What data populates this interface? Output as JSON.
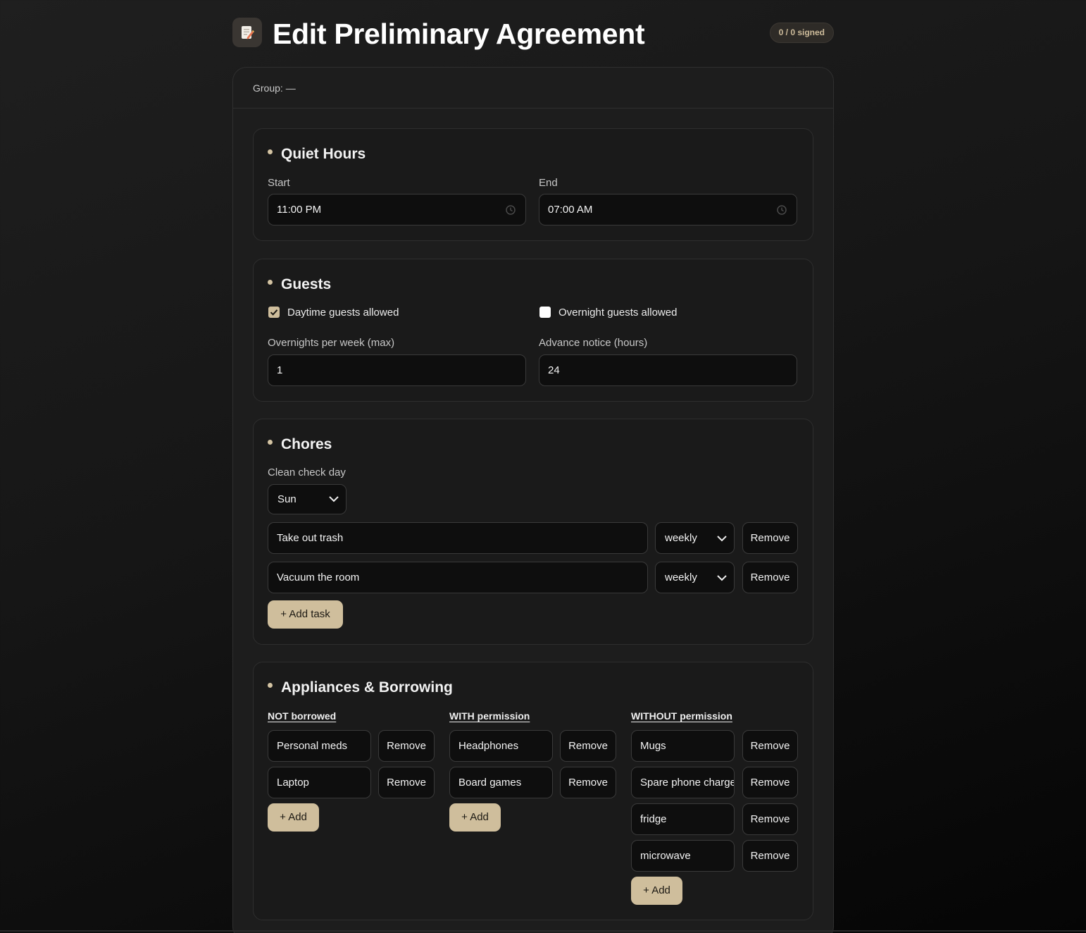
{
  "header": {
    "title": "Edit Preliminary Agreement",
    "signed_badge": "0 / 0 signed",
    "icon": "memo-pencil-icon"
  },
  "card": {
    "group_label": "Group: —"
  },
  "quiet_hours": {
    "title": "Quiet Hours",
    "start_label": "Start",
    "start_value": "11:00 PM",
    "end_label": "End",
    "end_value": "07:00 AM"
  },
  "guests": {
    "title": "Guests",
    "daytime_label": "Daytime guests allowed",
    "daytime_checked": true,
    "overnight_label": "Overnight guests allowed",
    "overnight_checked": false,
    "overnights_label": "Overnights per week (max)",
    "overnights_value": "1",
    "notice_label": "Advance notice (hours)",
    "notice_value": "24"
  },
  "chores": {
    "title": "Chores",
    "clean_day_label": "Clean check day",
    "clean_day_value": "Sun",
    "tasks": [
      {
        "name": "Take out trash",
        "frequency": "weekly",
        "remove": "Remove"
      },
      {
        "name": "Vacuum the room",
        "frequency": "weekly",
        "remove": "Remove"
      }
    ],
    "add_task": "+ Add task"
  },
  "appliances": {
    "title": "Appliances & Borrowing",
    "columns": [
      {
        "heading": "NOT borrowed",
        "items": [
          "Personal meds",
          "Laptop"
        ],
        "add": "+ Add"
      },
      {
        "heading": "WITH permission",
        "items": [
          "Headphones",
          "Board games"
        ],
        "add": "+ Add"
      },
      {
        "heading": "WITHOUT permission",
        "items": [
          "Mugs",
          "Spare phone charger",
          "fridge",
          "microwave"
        ],
        "add": "+ Add"
      }
    ],
    "remove_label": "Remove"
  },
  "colors": {
    "accent": "#cfbe9c",
    "background": "#161616",
    "card": "#1d1d1d",
    "field": "#0e0e0e"
  }
}
